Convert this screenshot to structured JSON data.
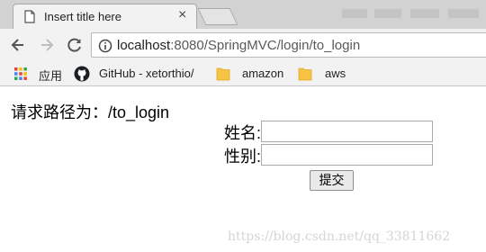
{
  "browser": {
    "tab": {
      "title": "Insert title here",
      "close_glyph": "×"
    },
    "address": {
      "host": "localhost",
      "rest": ":8080/SpringMVC/login/to_login"
    },
    "bookmarks": [
      {
        "label": "应用",
        "icon": "apps-grid-icon"
      },
      {
        "label": "GitHub - xetorthio/",
        "icon": "github-icon"
      },
      {
        "label": "amazon",
        "icon": "folder-icon"
      },
      {
        "label": "aws",
        "icon": "folder-icon"
      }
    ]
  },
  "page": {
    "heading": "请求路径为：/to_login",
    "form": {
      "name_label": "姓名:",
      "name_value": "",
      "gender_label": "性别:",
      "gender_value": "",
      "submit_label": "提交"
    },
    "watermark": "https://blog.csdn.net/qq_33811662"
  },
  "colors": {
    "tab_strip": "#d2d2d2",
    "toolbar": "#f2f2f2",
    "github_dark": "#1b1f23",
    "folder": "#f6c342"
  }
}
